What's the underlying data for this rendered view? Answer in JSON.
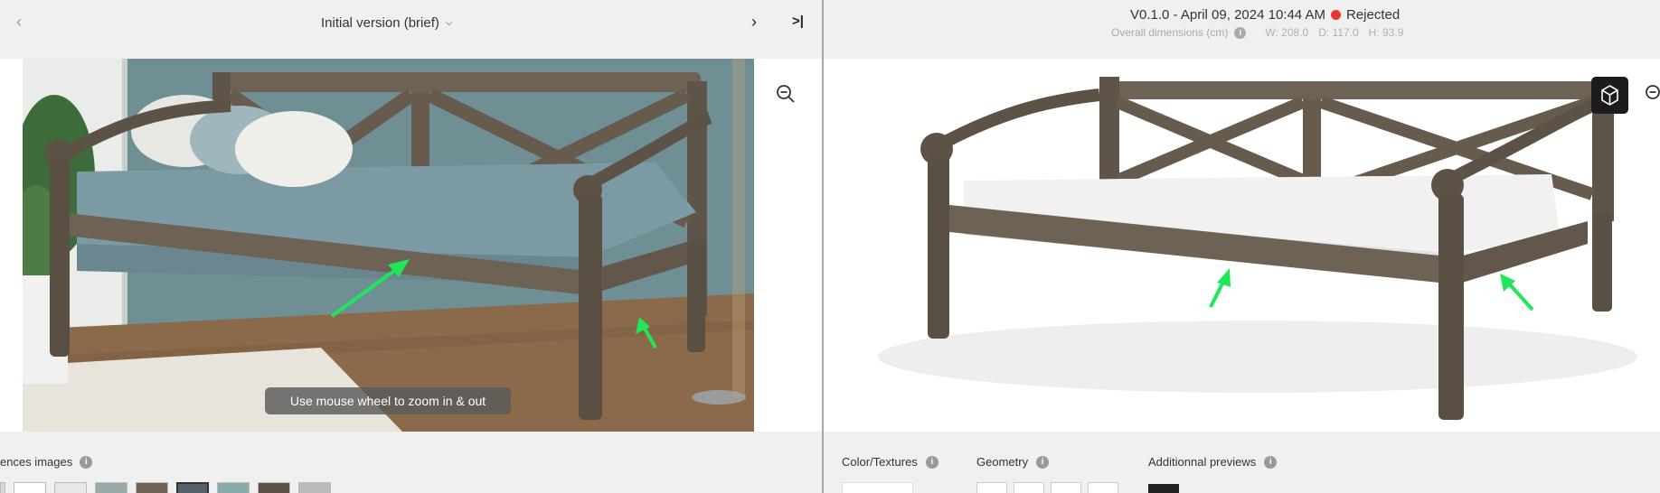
{
  "left_panel": {
    "nav": {
      "prev_icon": "chevron-left-icon",
      "version_label": "Initial version (brief)",
      "next_icon": "chevron-right-icon",
      "last_icon": "skip-to-last-icon"
    },
    "viewer": {
      "zoom_icon": "zoom-out-icon",
      "zoom_hint": "Use mouse wheel to zoom in & out"
    },
    "footer": {
      "references_label": "ences images",
      "info_icon": "info-icon",
      "thumbnail_count": 9,
      "active_thumbnail": 5
    }
  },
  "right_panel": {
    "header": {
      "version": "V0.1.0 - April 09, 2024 10:44 AM",
      "status": "Rejected",
      "status_color": "#e53935",
      "dimensions_label": "Overall dimensions (cm)",
      "width": "W: 208.0",
      "depth": "D: 117.0",
      "height": "H: 93.9"
    },
    "viewer": {
      "view_3d_icon": "cube-icon",
      "zoom_icon": "zoom-out-icon"
    },
    "footer": {
      "color_textures_label": "Color/Textures",
      "geometry_label": "Geometry",
      "additional_previews_label": "Additionnal previews"
    }
  },
  "colors": {
    "annotation_arrow": "#1ee85a",
    "panel_bg": "#f0f0f0",
    "divider": "#a8a8a8"
  }
}
